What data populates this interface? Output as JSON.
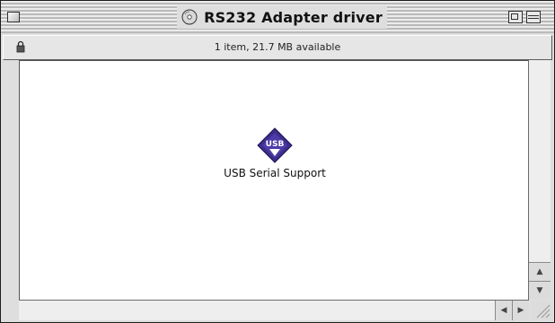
{
  "window": {
    "title": "RS232 Adapter driver",
    "info": "1 item, 21.7 MB available"
  },
  "items": [
    {
      "label": "USB Serial Support",
      "icon": "usb-installer-icon",
      "badge_text": "USB"
    }
  ],
  "icons": {
    "title_icon": "cd-disk-icon",
    "header_icon": "lock-icon",
    "close": "close-box",
    "zoom": "zoom-box",
    "collapse": "collapse-box"
  },
  "colors": {
    "accent": "#3c2d8c",
    "window_bg": "#dedede",
    "content_bg": "#ffffff"
  }
}
